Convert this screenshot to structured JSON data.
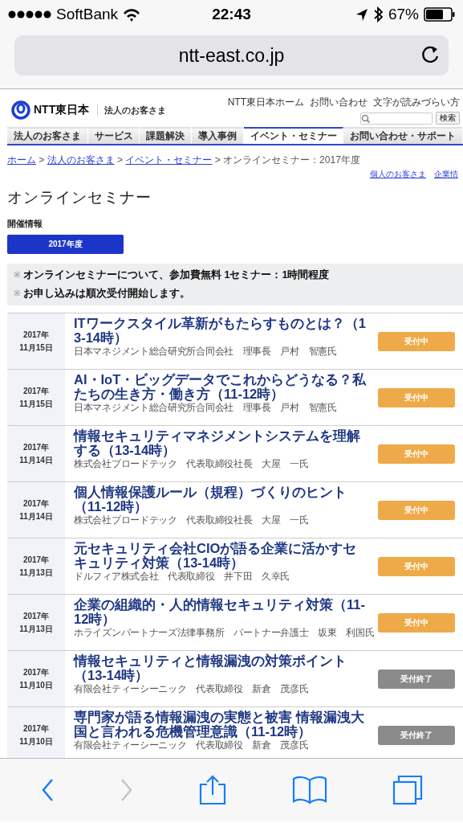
{
  "status_bar": {
    "carrier": "SoftBank",
    "time": "22:43",
    "battery": "67%"
  },
  "address_bar": {
    "url": "ntt-east.co.jp"
  },
  "header": {
    "brand": "NTT東日本",
    "section": "法人のお客さま",
    "top_links": [
      "NTT東日本ホーム",
      "お問い合わせ",
      "文字が読みづらい方"
    ],
    "search_button": "検索",
    "nav": [
      {
        "label": "法人のお客さま",
        "selected": false
      },
      {
        "label": "サービス",
        "selected": false
      },
      {
        "label": "課題解決",
        "selected": false
      },
      {
        "label": "導入事例",
        "selected": false
      },
      {
        "label": "イベント・セミナー",
        "selected": true
      },
      {
        "label": "お問い合わせ・サポート",
        "selected": false
      }
    ]
  },
  "breadcrumb": {
    "separator": ">",
    "links": [
      "ホーム",
      "法人のお客さま",
      "イベント・セミナー"
    ],
    "current": "オンラインセミナー：2017年度"
  },
  "side_links": [
    "個人のお客さま",
    "企業情"
  ],
  "page_title": "オンラインセミナー",
  "section_label": "開催情報",
  "year_button": "2017年度",
  "notices": [
    {
      "mark": "※",
      "text": "オンラインセミナーについて、参加費無料 1セミナー：1時間程度"
    },
    {
      "mark": "※",
      "text": "お申し込みは順次受付開始します。"
    }
  ],
  "seminars": [
    {
      "year": "2017年",
      "day": "11月15日",
      "title": "ITワークスタイル革新がもたらすものとは？（13-14時）",
      "speaker": "日本マネジメント総合研究所合同会社　理事長　戸村　智憲氏",
      "status": "受付中",
      "closed": false
    },
    {
      "year": "2017年",
      "day": "11月15日",
      "title": "AI・IoT・ビッグデータでこれからどうなる？私たちの生き方・働き方（11-12時）",
      "speaker": "日本マネジメント総合研究所合同会社　理事長　戸村　智憲氏",
      "status": "受付中",
      "closed": false
    },
    {
      "year": "2017年",
      "day": "11月14日",
      "title": "情報セキュリティマネジメントシステムを理解する（13-14時）",
      "speaker": "株式会社ブロードテック　代表取締役社長　大屋　一氏",
      "status": "受付中",
      "closed": false
    },
    {
      "year": "2017年",
      "day": "11月14日",
      "title": "個人情報保護ルール（規程）づくりのヒント（11-12時）",
      "speaker": "株式会社ブロードテック　代表取締役社長　大屋　一氏",
      "status": "受付中",
      "closed": false
    },
    {
      "year": "2017年",
      "day": "11月13日",
      "title": "元セキュリティ会社CIOが語る企業に活かすセキュリティ対策（13-14時）",
      "speaker": "ドルフィア株式会社　代表取締役　井下田　久幸氏",
      "status": "受付中",
      "closed": false
    },
    {
      "year": "2017年",
      "day": "11月13日",
      "title": "企業の組織的・人的情報セキュリティ対策（11-12時）",
      "speaker": "ホライズンパートナーズ法律事務所　パートナー弁護士　坂東　利国氏",
      "status": "受付中",
      "closed": false
    },
    {
      "year": "2017年",
      "day": "11月10日",
      "title": "情報セキュリティと情報漏洩の対策ポイント（13-14時）",
      "speaker": "有限会社ティーシーニック　代表取締役　新倉　茂彦氏",
      "status": "受付終了",
      "closed": true
    },
    {
      "year": "2017年",
      "day": "11月10日",
      "title": "専門家が語る情報漏洩の実態と被害 情報漏洩大国と言われる危機管理意識（11-12時）",
      "speaker": "有限会社ティーシーニック　代表取締役　新倉　茂彦氏",
      "status": "受付終了",
      "closed": true
    }
  ],
  "toolbar": {
    "back_disabled": false,
    "forward_disabled": true
  }
}
